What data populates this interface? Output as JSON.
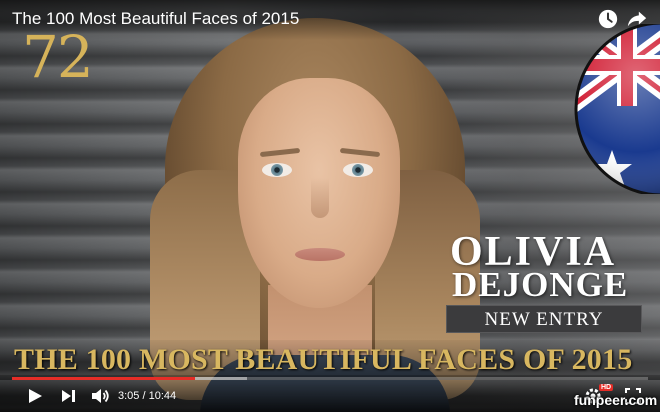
{
  "video": {
    "title": "The 100 Most Beautiful Faces of 2015",
    "rank": "72",
    "name_first": "OLIVIA",
    "name_last": "DEJONGE",
    "entry_badge": "NEW ENTRY",
    "banner": "THE 100 MOST BEAUTIFUL FACES OF 2015",
    "country_flag": "australia-flag"
  },
  "player": {
    "current_time": "3:05",
    "separator": " / ",
    "duration": "10:44",
    "hd_label": "HD",
    "progress_fraction": 0.287,
    "buffered_fraction": 0.37,
    "icons": [
      "watch-later-icon",
      "share-icon",
      "play-icon",
      "next-icon",
      "volume-icon",
      "settings-icon",
      "fullscreen-icon"
    ]
  },
  "watermark": "funpeer.com",
  "colors": {
    "gold": "#d6b35a",
    "progress_red": "#e52d27",
    "flag_blue": "#1a3a8f",
    "flag_red": "#cf142b"
  }
}
